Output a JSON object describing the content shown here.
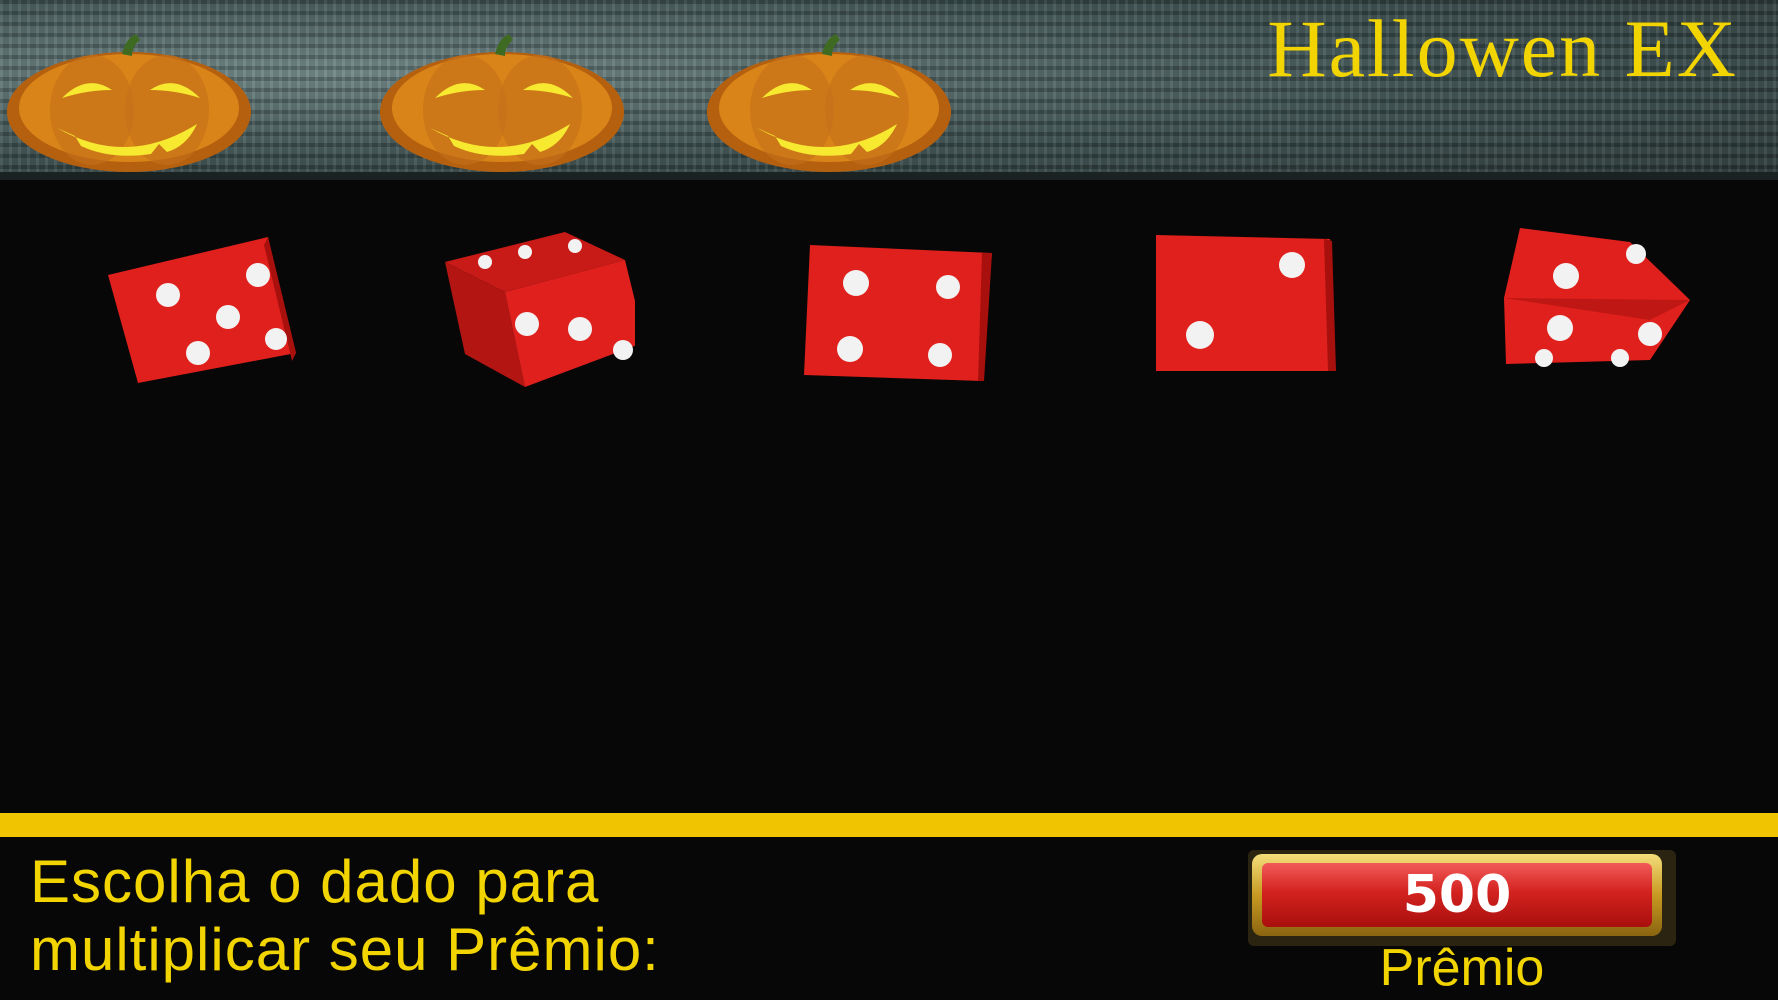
{
  "header": {
    "title": "Hallowen EX",
    "decorations": [
      "pumpkin-icon",
      "pumpkin-icon",
      "pumpkin-icon"
    ]
  },
  "dice": [
    {
      "label": "die-1",
      "visible_pips": 5
    },
    {
      "label": "die-2",
      "visible_pips": 3
    },
    {
      "label": "die-3",
      "visible_pips": 4
    },
    {
      "label": "die-4",
      "visible_pips": 2
    },
    {
      "label": "die-5",
      "visible_pips": 3
    }
  ],
  "footer": {
    "prompt_line1": "Escolha o dado para",
    "prompt_line2": "multiplicar seu Prêmio:",
    "prize_value": "500",
    "prize_label": "Prêmio"
  },
  "colors": {
    "title": "#f2d500",
    "divider": "#f0c400",
    "die": "#e0201c",
    "pip": "#f2f2f2",
    "prize": "#d32320"
  }
}
